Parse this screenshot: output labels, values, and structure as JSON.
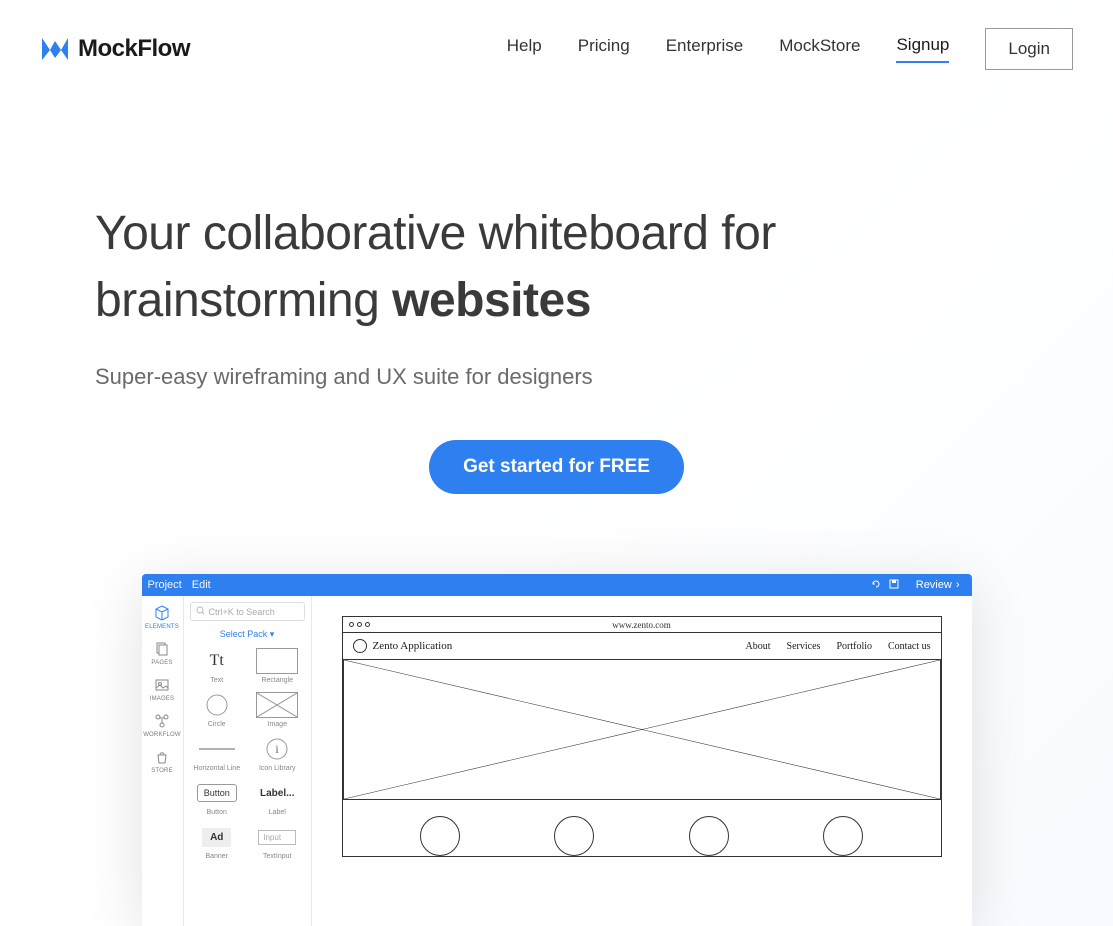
{
  "header": {
    "logo_text": "MockFlow",
    "nav": [
      {
        "label": "Help",
        "active": false
      },
      {
        "label": "Pricing",
        "active": false
      },
      {
        "label": "Enterprise",
        "active": false
      },
      {
        "label": "MockStore",
        "active": false
      },
      {
        "label": "Signup",
        "active": true
      }
    ],
    "login_label": "Login"
  },
  "hero": {
    "title_prefix": "Your collaborative whiteboard for brainstorming ",
    "title_bold": "websites",
    "subtitle": "Super-easy wireframing and UX suite for designers",
    "cta_label": "Get started for FREE"
  },
  "mock": {
    "topbar": {
      "project": "Project",
      "edit": "Edit",
      "review": "Review"
    },
    "rail": [
      {
        "id": "elements",
        "label": "ELEMENTS",
        "sel": true
      },
      {
        "id": "pages",
        "label": "PAGES",
        "sel": false
      },
      {
        "id": "images",
        "label": "IMAGES",
        "sel": false
      },
      {
        "id": "workflow",
        "label": "WORKFLOW",
        "sel": false
      },
      {
        "id": "store",
        "label": "STORE",
        "sel": false
      }
    ],
    "panel": {
      "search_placeholder": "Ctrl+K to Search",
      "select_pack": "Select Pack  ▾",
      "elements": [
        {
          "label": "Text",
          "kind": "text",
          "glyph": "Tt"
        },
        {
          "label": "Rectangle",
          "kind": "rect"
        },
        {
          "label": "Circle",
          "kind": "circle"
        },
        {
          "label": "Image",
          "kind": "image"
        },
        {
          "label": "Horizontal Line",
          "kind": "hline"
        },
        {
          "label": "Icon Library",
          "kind": "iconlib",
          "glyph": "i"
        },
        {
          "label": "Button",
          "kind": "button",
          "glyph": "Button"
        },
        {
          "label": "Label",
          "kind": "label",
          "glyph": "Label..."
        },
        {
          "label": "Banner",
          "kind": "ad",
          "glyph": "Ad"
        },
        {
          "label": "TextInput",
          "kind": "input",
          "glyph": "Input"
        }
      ]
    },
    "canvas": {
      "url": "www.zento.com",
      "app_title": "Zento Application",
      "menu": [
        "About",
        "Services",
        "Portfolio",
        "Contact us"
      ]
    }
  }
}
